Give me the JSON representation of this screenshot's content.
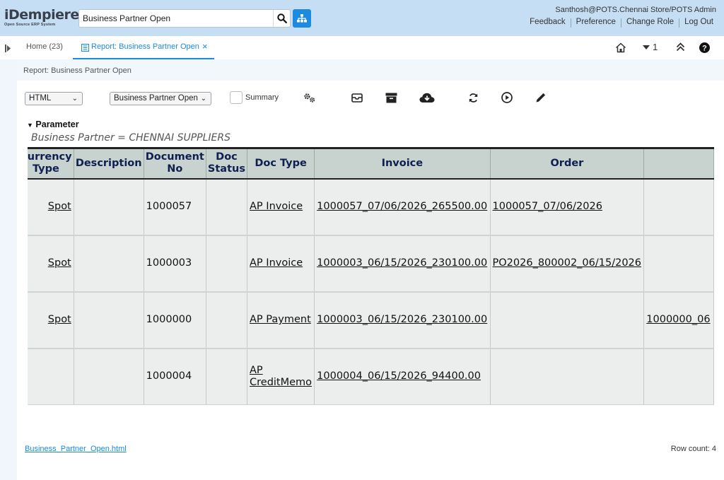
{
  "header": {
    "brand": "iDempiere",
    "tagline": "Open Source ERP System",
    "search_value": "Business Partner Open",
    "user": "Santhosh@POTS.Chennai Store/POTS Admin",
    "links": [
      "Feedback",
      "Preference",
      "Change Role",
      "Log Out"
    ]
  },
  "tabs": {
    "home": "Home (23)",
    "report": "Report: Business Partner Open",
    "close": "×",
    "window_count": "1"
  },
  "breadcrumb": "Report: Business Partner Open",
  "toolbar": {
    "format": "HTML",
    "print_format": "Business Partner Open",
    "summary_label": "Summary"
  },
  "parameter": {
    "title": "Parameter",
    "value": "Business Partner = CHENNAI SUPPLIERS"
  },
  "table": {
    "headers": [
      "Currency Type",
      "Description",
      "Document No",
      "Doc Status",
      "Doc Type",
      "Invoice",
      "Order",
      ""
    ],
    "rows": [
      [
        "Spot",
        "",
        "1000057",
        "",
        "AP Invoice",
        "1000057_07/06/2026_265500.00",
        "1000057_07/06/2026",
        ""
      ],
      [
        "Spot",
        "",
        "1000003",
        "",
        "AP Invoice",
        "1000003_06/15/2026_230100.00",
        "PO2026_800002_06/15/2026",
        ""
      ],
      [
        "Spot",
        "",
        "1000000",
        "",
        "AP Payment",
        "1000003_06/15/2026_230100.00",
        "",
        "1000000_06"
      ],
      [
        "",
        "",
        "1000004",
        "",
        "AP CreditMemo",
        "1000004_06/15/2026_94400.00",
        "",
        ""
      ]
    ]
  },
  "footer": {
    "file_link": "Business_Partner_Open.html",
    "row_count": "Row count: 4"
  },
  "colors": {
    "accent": "#1a8be0",
    "header_bg": "#c5def3",
    "table_header_bg": "#c8d2cf"
  }
}
